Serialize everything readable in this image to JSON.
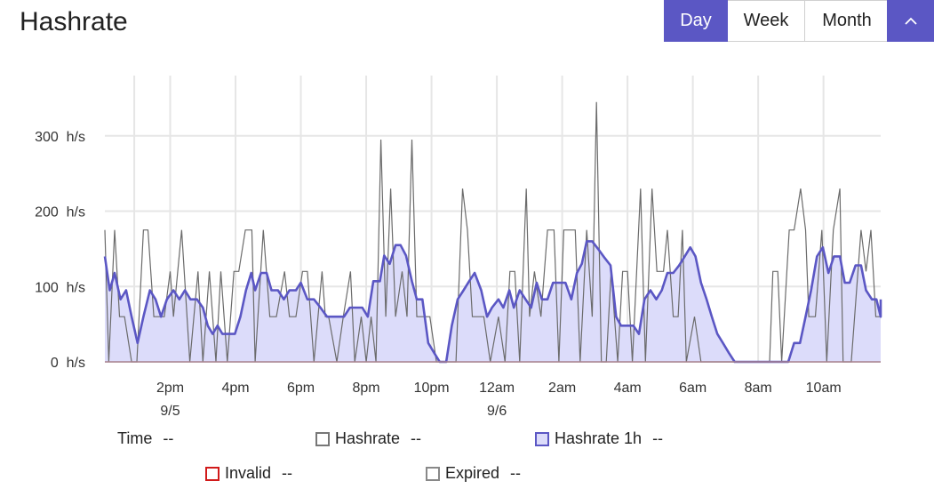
{
  "header": {
    "title": "Hashrate"
  },
  "range": {
    "day": "Day",
    "week": "Week",
    "month": "Month"
  },
  "collapse_icon": "chevron-up-icon",
  "colors": {
    "accent": "#5b57c4",
    "hashrate": "#6b6b6b",
    "hashrate1h": "#5b57c4",
    "fill1h": "#dcdcfa",
    "invalid": "#d11a1a",
    "expired": "#888888",
    "grid": "#e6e6e6"
  },
  "legend": {
    "time": {
      "label": "Time",
      "value": "--"
    },
    "hashrate": {
      "label": "Hashrate",
      "value": "--"
    },
    "hashrate1h": {
      "label": "Hashrate 1h",
      "value": "--"
    },
    "invalid": {
      "label": "Invalid",
      "value": "--"
    },
    "expired": {
      "label": "Expired",
      "value": "--"
    }
  },
  "chart_data": {
    "type": "area",
    "title": "Hashrate",
    "ylim": [
      0,
      380
    ],
    "yticks": [
      {
        "v": 0,
        "label": "0 h/s"
      },
      {
        "v": 100,
        "label": "100 h/s"
      },
      {
        "v": 200,
        "label": "200 h/s"
      },
      {
        "v": 300,
        "label": "300 h/s"
      }
    ],
    "xlim": [
      12.0,
      35.75
    ],
    "xticks": [
      {
        "t": 14,
        "label": "2pm",
        "sub": "9/5"
      },
      {
        "t": 16,
        "label": "4pm",
        "sub": ""
      },
      {
        "t": 18,
        "label": "6pm",
        "sub": ""
      },
      {
        "t": 20,
        "label": "8pm",
        "sub": ""
      },
      {
        "t": 22,
        "label": "10pm",
        "sub": ""
      },
      {
        "t": 24,
        "label": "12am",
        "sub": "9/6"
      },
      {
        "t": 26,
        "label": "2am",
        "sub": ""
      },
      {
        "t": 28,
        "label": "4am",
        "sub": ""
      },
      {
        "t": 30,
        "label": "6am",
        "sub": ""
      },
      {
        "t": 32,
        "label": "8am",
        "sub": ""
      },
      {
        "t": 34,
        "label": "10am",
        "sub": ""
      }
    ],
    "grid": true,
    "x_unit": "hours since 2021-09-05 00:00",
    "series": [
      {
        "name": "Hashrate",
        "kind": "line",
        "points": [
          [
            12.0,
            175
          ],
          [
            12.12,
            0
          ],
          [
            12.3,
            175
          ],
          [
            12.45,
            60
          ],
          [
            12.6,
            60
          ],
          [
            12.82,
            0
          ],
          [
            12.98,
            0
          ],
          [
            13.18,
            175
          ],
          [
            13.32,
            175
          ],
          [
            13.5,
            60
          ],
          [
            13.72,
            60
          ],
          [
            13.82,
            60
          ],
          [
            14.0,
            120
          ],
          [
            14.1,
            60
          ],
          [
            14.35,
            175
          ],
          [
            14.6,
            0
          ],
          [
            14.85,
            120
          ],
          [
            15.0,
            0
          ],
          [
            15.2,
            120
          ],
          [
            15.4,
            0
          ],
          [
            15.55,
            120
          ],
          [
            15.75,
            0
          ],
          [
            15.95,
            120
          ],
          [
            16.1,
            120
          ],
          [
            16.3,
            175
          ],
          [
            16.5,
            175
          ],
          [
            16.6,
            0
          ],
          [
            16.85,
            175
          ],
          [
            17.05,
            60
          ],
          [
            17.25,
            60
          ],
          [
            17.5,
            120
          ],
          [
            17.65,
            60
          ],
          [
            17.85,
            60
          ],
          [
            18.05,
            120
          ],
          [
            18.2,
            120
          ],
          [
            18.4,
            0
          ],
          [
            18.65,
            120
          ],
          [
            18.75,
            60
          ],
          [
            18.85,
            60
          ],
          [
            19.1,
            0
          ],
          [
            19.3,
            60
          ],
          [
            19.52,
            120
          ],
          [
            19.65,
            0
          ],
          [
            19.85,
            60
          ],
          [
            20.0,
            0
          ],
          [
            20.15,
            60
          ],
          [
            20.3,
            0
          ],
          [
            20.45,
            295
          ],
          [
            20.6,
            60
          ],
          [
            20.75,
            230
          ],
          [
            20.9,
            60
          ],
          [
            21.1,
            120
          ],
          [
            21.25,
            60
          ],
          [
            21.4,
            295
          ],
          [
            21.55,
            60
          ],
          [
            21.75,
            60
          ],
          [
            21.95,
            60
          ],
          [
            22.15,
            0
          ],
          [
            22.3,
            0
          ],
          [
            22.45,
            0
          ],
          [
            22.6,
            0
          ],
          [
            22.75,
            0
          ],
          [
            22.95,
            230
          ],
          [
            23.1,
            175
          ],
          [
            23.25,
            60
          ],
          [
            23.45,
            60
          ],
          [
            23.6,
            60
          ],
          [
            23.8,
            0
          ],
          [
            24.05,
            60
          ],
          [
            24.25,
            0
          ],
          [
            24.4,
            120
          ],
          [
            24.55,
            120
          ],
          [
            24.7,
            0
          ],
          [
            24.9,
            230
          ],
          [
            25.0,
            60
          ],
          [
            25.15,
            120
          ],
          [
            25.35,
            60
          ],
          [
            25.55,
            175
          ],
          [
            25.75,
            175
          ],
          [
            25.9,
            0
          ],
          [
            26.05,
            175
          ],
          [
            26.4,
            175
          ],
          [
            26.55,
            0
          ],
          [
            26.75,
            175
          ],
          [
            26.92,
            60
          ],
          [
            27.05,
            345
          ],
          [
            27.2,
            0
          ],
          [
            27.35,
            0
          ],
          [
            27.5,
            120
          ],
          [
            27.7,
            0
          ],
          [
            27.85,
            120
          ],
          [
            28.0,
            120
          ],
          [
            28.15,
            0
          ],
          [
            28.4,
            230
          ],
          [
            28.55,
            0
          ],
          [
            28.75,
            230
          ],
          [
            28.9,
            120
          ],
          [
            29.1,
            120
          ],
          [
            29.22,
            175
          ],
          [
            29.4,
            60
          ],
          [
            29.55,
            60
          ],
          [
            29.68,
            175
          ],
          [
            29.8,
            0
          ],
          [
            30.05,
            60
          ],
          [
            30.25,
            0
          ],
          [
            30.5,
            0
          ],
          [
            30.75,
            0
          ],
          [
            31.0,
            0
          ],
          [
            31.5,
            0
          ],
          [
            32.0,
            0
          ],
          [
            32.35,
            0
          ],
          [
            32.45,
            120
          ],
          [
            32.6,
            120
          ],
          [
            32.72,
            0
          ],
          [
            32.95,
            175
          ],
          [
            33.1,
            175
          ],
          [
            33.3,
            230
          ],
          [
            33.45,
            175
          ],
          [
            33.55,
            60
          ],
          [
            33.75,
            60
          ],
          [
            33.95,
            175
          ],
          [
            34.1,
            0
          ],
          [
            34.3,
            175
          ],
          [
            34.5,
            230
          ],
          [
            34.6,
            0
          ],
          [
            34.85,
            0
          ],
          [
            35.15,
            175
          ],
          [
            35.3,
            120
          ],
          [
            35.45,
            175
          ],
          [
            35.6,
            60
          ],
          [
            35.75,
            60
          ]
        ]
      },
      {
        "name": "Hashrate 1h",
        "kind": "area",
        "points": [
          [
            12.0,
            140
          ],
          [
            12.15,
            95
          ],
          [
            12.3,
            118
          ],
          [
            12.48,
            83
          ],
          [
            12.65,
            95
          ],
          [
            12.82,
            60
          ],
          [
            13.0,
            25
          ],
          [
            13.18,
            60
          ],
          [
            13.38,
            95
          ],
          [
            13.55,
            83
          ],
          [
            13.72,
            60
          ],
          [
            13.9,
            83
          ],
          [
            14.1,
            95
          ],
          [
            14.28,
            83
          ],
          [
            14.45,
            95
          ],
          [
            14.62,
            83
          ],
          [
            14.82,
            83
          ],
          [
            15.0,
            72
          ],
          [
            15.15,
            48
          ],
          [
            15.3,
            37
          ],
          [
            15.45,
            48
          ],
          [
            15.6,
            37
          ],
          [
            15.8,
            37
          ],
          [
            15.98,
            37
          ],
          [
            16.15,
            60
          ],
          [
            16.32,
            95
          ],
          [
            16.48,
            118
          ],
          [
            16.6,
            95
          ],
          [
            16.78,
            118
          ],
          [
            16.95,
            118
          ],
          [
            17.1,
            95
          ],
          [
            17.3,
            95
          ],
          [
            17.48,
            83
          ],
          [
            17.65,
            95
          ],
          [
            17.85,
            95
          ],
          [
            18.0,
            105
          ],
          [
            18.2,
            83
          ],
          [
            18.4,
            83
          ],
          [
            18.6,
            72
          ],
          [
            18.8,
            60
          ],
          [
            18.98,
            60
          ],
          [
            19.15,
            60
          ],
          [
            19.32,
            60
          ],
          [
            19.5,
            72
          ],
          [
            19.7,
            72
          ],
          [
            19.88,
            72
          ],
          [
            20.05,
            60
          ],
          [
            20.22,
            107
          ],
          [
            20.42,
            107
          ],
          [
            20.55,
            141
          ],
          [
            20.72,
            130
          ],
          [
            20.9,
            155
          ],
          [
            21.05,
            155
          ],
          [
            21.22,
            141
          ],
          [
            21.4,
            107
          ],
          [
            21.55,
            83
          ],
          [
            21.72,
            83
          ],
          [
            21.9,
            25
          ],
          [
            22.08,
            12
          ],
          [
            22.25,
            0
          ],
          [
            22.45,
            0
          ],
          [
            22.62,
            48
          ],
          [
            22.8,
            83
          ],
          [
            22.98,
            95
          ],
          [
            23.15,
            107
          ],
          [
            23.32,
            118
          ],
          [
            23.52,
            95
          ],
          [
            23.7,
            60
          ],
          [
            23.85,
            72
          ],
          [
            24.05,
            83
          ],
          [
            24.2,
            72
          ],
          [
            24.38,
            95
          ],
          [
            24.52,
            72
          ],
          [
            24.7,
            95
          ],
          [
            24.88,
            83
          ],
          [
            25.05,
            72
          ],
          [
            25.22,
            105
          ],
          [
            25.38,
            83
          ],
          [
            25.55,
            83
          ],
          [
            25.72,
            105
          ],
          [
            25.92,
            105
          ],
          [
            26.1,
            105
          ],
          [
            26.28,
            83
          ],
          [
            26.45,
            118
          ],
          [
            26.6,
            130
          ],
          [
            26.75,
            160
          ],
          [
            26.92,
            160
          ],
          [
            27.1,
            150
          ],
          [
            27.3,
            138
          ],
          [
            27.48,
            128
          ],
          [
            27.65,
            60
          ],
          [
            27.8,
            48
          ],
          [
            28.0,
            48
          ],
          [
            28.18,
            48
          ],
          [
            28.35,
            37
          ],
          [
            28.52,
            83
          ],
          [
            28.7,
            95
          ],
          [
            28.88,
            83
          ],
          [
            29.05,
            95
          ],
          [
            29.22,
            118
          ],
          [
            29.4,
            118
          ],
          [
            29.58,
            128
          ],
          [
            29.75,
            140
          ],
          [
            29.92,
            152
          ],
          [
            30.08,
            140
          ],
          [
            30.25,
            105
          ],
          [
            30.42,
            83
          ],
          [
            30.58,
            60
          ],
          [
            30.75,
            37
          ],
          [
            30.92,
            25
          ],
          [
            31.1,
            12
          ],
          [
            31.28,
            0
          ],
          [
            31.5,
            0
          ],
          [
            32.0,
            0
          ],
          [
            32.5,
            0
          ],
          [
            32.75,
            0
          ],
          [
            32.92,
            0
          ],
          [
            33.1,
            25
          ],
          [
            33.28,
            25
          ],
          [
            33.45,
            60
          ],
          [
            33.62,
            95
          ],
          [
            33.8,
            140
          ],
          [
            33.98,
            152
          ],
          [
            34.15,
            118
          ],
          [
            34.32,
            140
          ],
          [
            34.5,
            140
          ],
          [
            34.65,
            105
          ],
          [
            34.8,
            105
          ],
          [
            34.98,
            128
          ],
          [
            35.15,
            128
          ],
          [
            35.3,
            95
          ],
          [
            35.48,
            83
          ],
          [
            35.62,
            83
          ],
          [
            35.8,
            60
          ],
          [
            36.0,
            60
          ],
          [
            36.2,
            72
          ],
          [
            36.38,
            83
          ]
        ]
      }
    ],
    "legend": [
      "Time",
      "Hashrate",
      "Hashrate 1h",
      "Invalid",
      "Expired"
    ]
  }
}
